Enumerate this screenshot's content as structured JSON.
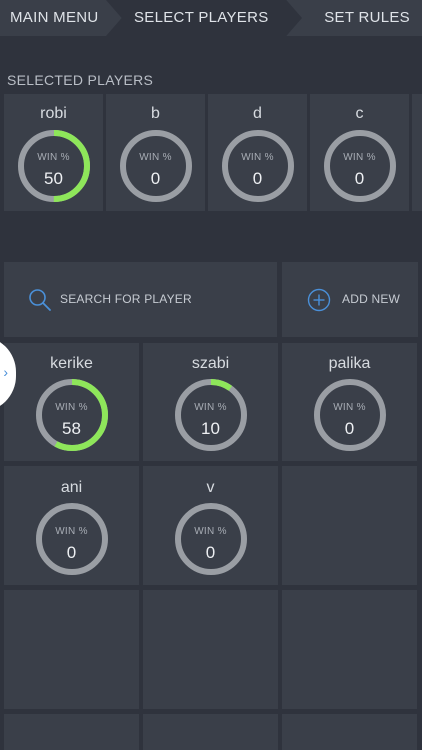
{
  "nav": {
    "main_menu": "MAIN MENU",
    "select_players": "SELECT PLAYERS",
    "set_rules": "SET RULES"
  },
  "selected": {
    "title": "SELECTED PLAYERS",
    "players": [
      {
        "name": "robi",
        "win_label": "WIN %",
        "win": "50",
        "fraction": 0.5
      },
      {
        "name": "b",
        "win_label": "WIN %",
        "win": "0",
        "fraction": 0
      },
      {
        "name": "d",
        "win_label": "WIN %",
        "win": "0",
        "fraction": 0
      },
      {
        "name": "c",
        "win_label": "WIN %",
        "win": "0",
        "fraction": 0
      }
    ]
  },
  "search": {
    "label": "SEARCH FOR PLAYER",
    "icon": "search-icon"
  },
  "add_new": {
    "label": "ADD NEW",
    "icon": "plus-circle-icon"
  },
  "players": [
    {
      "name": "kerike",
      "win_label": "WIN %",
      "win": "58",
      "fraction": 0.58
    },
    {
      "name": "szabi",
      "win_label": "WIN %",
      "win": "10",
      "fraction": 0.1
    },
    {
      "name": "palika",
      "win_label": "WIN %",
      "win": "0",
      "fraction": 0
    },
    {
      "name": "ani",
      "win_label": "WIN %",
      "win": "0",
      "fraction": 0
    },
    {
      "name": "v",
      "win_label": "WIN %",
      "win": "0",
      "fraction": 0
    }
  ],
  "colors": {
    "ring_track": "#9a9ea4",
    "ring_fill": "#8ee65a",
    "card_bg": "#3a3f49",
    "page_bg": "#2f333d"
  }
}
